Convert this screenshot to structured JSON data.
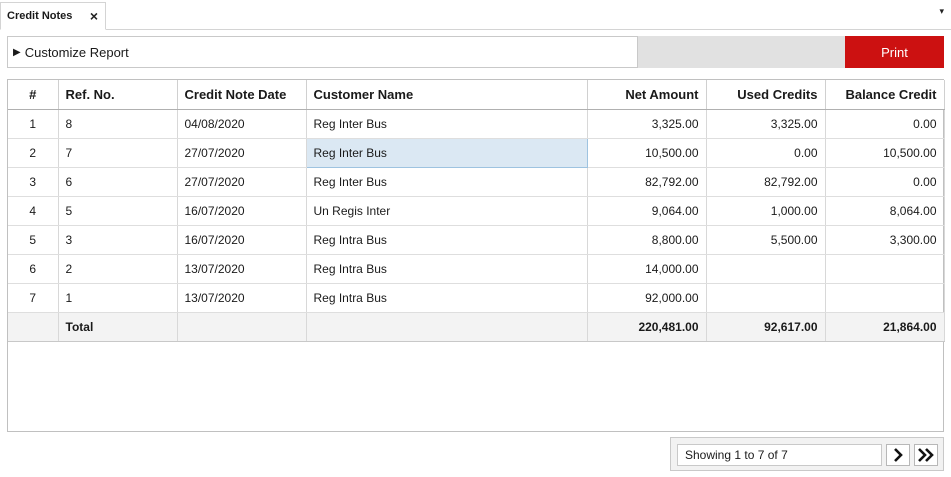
{
  "tab": {
    "title": "Credit Notes",
    "close_icon": "×",
    "menu_icon": "▾"
  },
  "customize": {
    "arrow_icon": "▶",
    "label": "Customize Report"
  },
  "print_button": {
    "label": "Print",
    "color": "#cc1111"
  },
  "grid": {
    "columns": [
      "#",
      "Ref. No.",
      "Credit Note Date",
      "Customer Name",
      "Net Amount",
      "Used Credits",
      "Balance Credit"
    ],
    "rows": [
      [
        "1",
        "8",
        "04/08/2020",
        "Reg Inter Bus",
        "3,325.00",
        "3,325.00",
        "0.00"
      ],
      [
        "2",
        "7",
        "27/07/2020",
        "Reg Inter Bus",
        "10,500.00",
        "0.00",
        "10,500.00"
      ],
      [
        "3",
        "6",
        "27/07/2020",
        "Reg Inter Bus",
        "82,792.00",
        "82,792.00",
        "0.00"
      ],
      [
        "4",
        "5",
        "16/07/2020",
        "Un Regis Inter",
        "9,064.00",
        "1,000.00",
        "8,064.00"
      ],
      [
        "5",
        "3",
        "16/07/2020",
        "Reg Intra Bus",
        "8,800.00",
        "5,500.00",
        "3,300.00"
      ],
      [
        "6",
        "2",
        "13/07/2020",
        "Reg Intra Bus",
        "14,000.00",
        "",
        ""
      ],
      [
        "7",
        "1",
        "13/07/2020",
        "Reg Intra Bus",
        "92,000.00",
        "",
        ""
      ]
    ],
    "total": [
      "",
      "Total",
      "",
      "",
      "220,481.00",
      "92,617.00",
      "21,864.00"
    ],
    "selected_row": 1,
    "selected_col": 3
  },
  "pager": {
    "info": "Showing 1 to 7 of 7",
    "next_icon": "chevron-right-icon",
    "last_icon": "double-chevron-right-icon"
  }
}
